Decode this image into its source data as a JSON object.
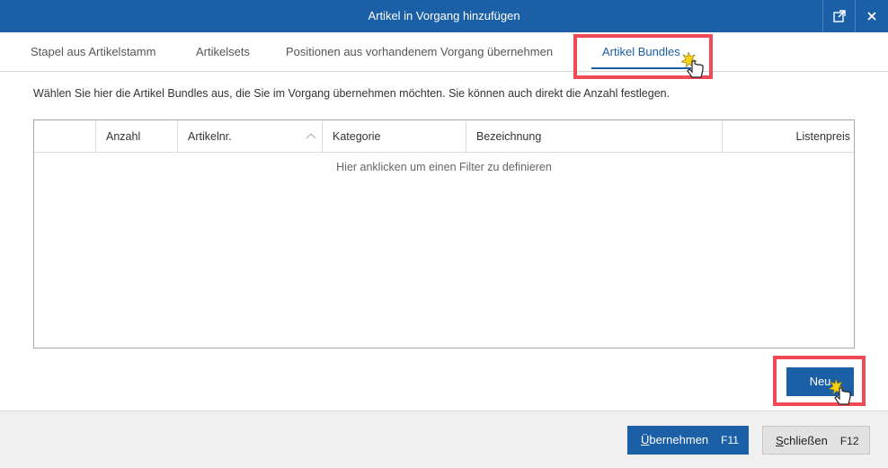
{
  "dialog": {
    "title": "Artikel in Vorgang hinzufügen"
  },
  "tabs": [
    {
      "label": "Stapel aus Artikelstamm"
    },
    {
      "label": "Artikelsets"
    },
    {
      "label": "Positionen aus vorhandenem Vorgang übernehmen"
    },
    {
      "label": "Artikel Bundles",
      "active": true
    }
  ],
  "description": "Wählen Sie hier die Artikel Bundles aus, die Sie im Vorgang übernehmen möchten. Sie können auch direkt die Anzahl festlegen.",
  "grid": {
    "columns": [
      "",
      "Anzahl",
      "Artikelnr.",
      "Kategorie",
      "Bezeichnung",
      "Listenpreis"
    ],
    "filter_hint": "Hier anklicken um einen Filter zu definieren"
  },
  "new_button": "Neu",
  "footer": {
    "apply": {
      "label_first": "Ü",
      "label_rest": "bernehmen",
      "shortcut": "F11"
    },
    "close": {
      "label_first": "S",
      "label_rest": "chließen",
      "shortcut": "F12"
    }
  },
  "colors": {
    "accent": "#1b5fa6",
    "highlight": "#f04a57"
  }
}
